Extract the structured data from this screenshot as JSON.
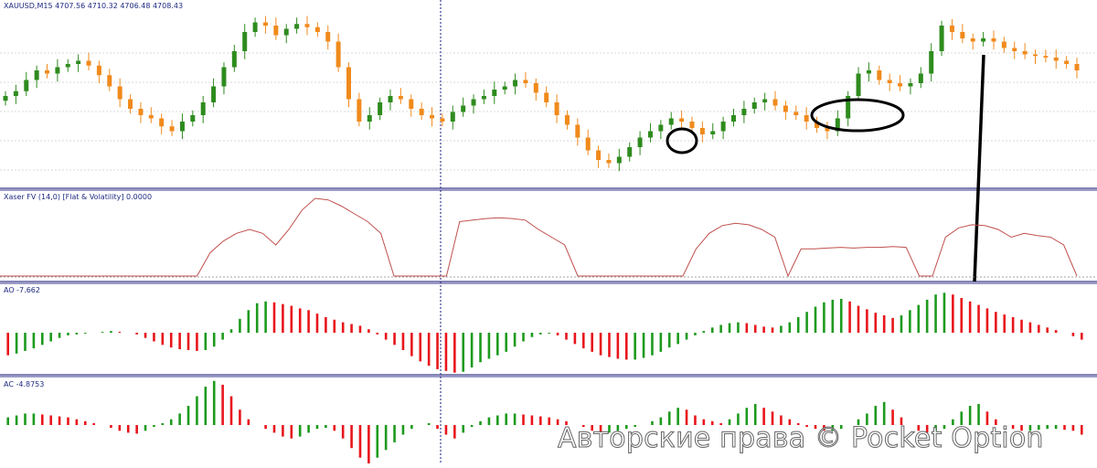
{
  "colors": {
    "bull_candle": "#2e8b1e",
    "bear_candle": "#f08a1c",
    "ao_up": "#1d9a1d",
    "ao_down": "#e8151b",
    "flat_line": "#c0504d",
    "separator": "#3a3a8c",
    "grid": "#d8d8d8",
    "vline": "#1a1a80",
    "annotation": "#000000",
    "watermark_stroke": "#555555"
  },
  "panels": {
    "price": {
      "label": "XAUUSD,M15  4707.56 4710.32 4706.48 4708.43"
    },
    "flat": {
      "label": "Xaser FV (14,0) [Flat & Volatility] 0.0000"
    },
    "ao": {
      "label": "AO -7.662"
    },
    "ac": {
      "label": "AC -4.8753"
    }
  },
  "watermark": "Авторские права © Pocket Option",
  "chart_data": [
    {
      "type": "candlestick",
      "panel": "price",
      "symbol": "XAUUSD",
      "timeframe": "M15",
      "title": "XAUUSD,M15  4707.56 4710.32 4706.48 4708.43",
      "ohlc_last": {
        "open": 4707.56,
        "high": 4710.32,
        "low": 4706.48,
        "close": 4708.43
      },
      "close_path_relative": [
        52,
        55,
        62,
        68,
        66,
        70,
        72,
        74,
        71,
        65,
        58,
        50,
        44,
        40,
        38,
        33,
        30,
        36,
        40,
        48,
        58,
        70,
        80,
        92,
        98,
        96,
        90,
        94,
        97,
        95,
        92,
        86,
        70,
        50,
        36,
        40,
        48,
        52,
        50,
        44,
        40,
        38,
        36,
        42,
        46,
        50,
        52,
        56,
        58,
        62,
        60,
        54,
        48,
        40,
        34,
        26,
        18,
        12,
        10,
        14,
        20,
        26,
        30,
        34,
        38,
        36,
        32,
        28,
        30,
        36,
        40,
        44,
        48,
        50,
        46,
        42,
        40,
        36,
        32,
        30,
        38,
        52,
        66,
        68,
        62,
        60,
        58,
        60,
        66,
        80,
        96,
        92,
        88,
        86,
        88,
        86,
        82,
        80,
        78,
        77,
        76,
        74,
        72,
        68
      ],
      "annotations": [
        "small-circle",
        "ellipse",
        "vertical-line"
      ],
      "grid": true
    },
    {
      "type": "line",
      "panel": "flat",
      "title": "Xaser FV (14,0) [Flat & Volatility] 0.0000",
      "value_last": 0.0,
      "segments_relative": [
        [
          0,
          0,
          0,
          0,
          0,
          0,
          0,
          0,
          0,
          0,
          0,
          0,
          0,
          0,
          0,
          0
        ],
        [
          30,
          45,
          55,
          60,
          55,
          40,
          60,
          85,
          100,
          98,
          90,
          80,
          70,
          55,
          0
        ],
        [
          0,
          0,
          0,
          0
        ],
        [
          70,
          72,
          74,
          75,
          74,
          72,
          60,
          50,
          40,
          0
        ],
        [
          0,
          0,
          0,
          0,
          0,
          0,
          0,
          0
        ],
        [
          35,
          55,
          65,
          68,
          66,
          60,
          50,
          0
        ],
        [
          35,
          35,
          36,
          37,
          36,
          37,
          37,
          38,
          37,
          0
        ],
        [
          0
        ],
        [
          50,
          62,
          66,
          65,
          60,
          50,
          55,
          52,
          50,
          40,
          0
        ]
      ]
    },
    {
      "type": "bar",
      "panel": "ao",
      "title": "AO -7.662",
      "value_last": -7.662,
      "values": [
        -26,
        -24,
        -21,
        -18,
        -14,
        -10,
        -6,
        -3,
        -2,
        -1,
        0,
        1,
        2,
        1,
        0,
        -2,
        -6,
        -10,
        -14,
        -17,
        -19,
        -20,
        -21,
        -20,
        -16,
        -8,
        4,
        16,
        26,
        34,
        36,
        35,
        33,
        31,
        28,
        26,
        22,
        18,
        15,
        12,
        10,
        8,
        4,
        -2,
        -8,
        -14,
        -20,
        -27,
        -33,
        -38,
        -42,
        -44,
        -46,
        -45,
        -40,
        -34,
        -30,
        -26,
        -22,
        -16,
        -10,
        -5,
        -2,
        -1,
        -3,
        -8,
        -13,
        -18,
        -22,
        -26,
        -28,
        -30,
        -31,
        -31,
        -29,
        -26,
        -22,
        -17,
        -13,
        -8,
        -3,
        2,
        6,
        9,
        11,
        12,
        11,
        9,
        7,
        6,
        8,
        12,
        18,
        24,
        30,
        35,
        38,
        39,
        36,
        31,
        27,
        23,
        20,
        17,
        20,
        26,
        32,
        38,
        44,
        46,
        44,
        40,
        36,
        32,
        28,
        24,
        21,
        18,
        15,
        12,
        9,
        6,
        3,
        0,
        -4,
        -8
      ],
      "grid": false
    },
    {
      "type": "bar",
      "panel": "ac",
      "title": "AC -4.8753",
      "value_last": -4.8753,
      "values": [
        8,
        10,
        12,
        12,
        11,
        10,
        9,
        8,
        6,
        4,
        2,
        0,
        -3,
        -6,
        -8,
        -9,
        -6,
        -2,
        2,
        6,
        12,
        20,
        30,
        40,
        46,
        42,
        30,
        16,
        6,
        0,
        -4,
        -8,
        -12,
        -14,
        -12,
        -8,
        -4,
        -3,
        -6,
        -14,
        -24,
        -34,
        -40,
        -34,
        -26,
        -18,
        -10,
        -4,
        0,
        2,
        -4,
        -10,
        -14,
        -8,
        -2,
        4,
        8,
        10,
        12,
        12,
        11,
        10,
        9,
        8,
        6,
        4,
        0,
        -2,
        -6,
        -8,
        -8,
        -6,
        -4,
        -2,
        0,
        4,
        8,
        14,
        18,
        16,
        10,
        6,
        4,
        2,
        6,
        12,
        18,
        22,
        18,
        14,
        10,
        6,
        2,
        -2,
        -4,
        -6,
        -6,
        -4,
        0,
        6,
        12,
        20,
        24,
        16,
        8,
        0,
        -6,
        -8,
        -6,
        -4,
        6,
        14,
        20,
        22,
        14,
        6,
        0,
        -4,
        -6,
        -6,
        -5,
        -4,
        -4,
        -5,
        -6,
        -10
      ],
      "grid": false
    }
  ]
}
